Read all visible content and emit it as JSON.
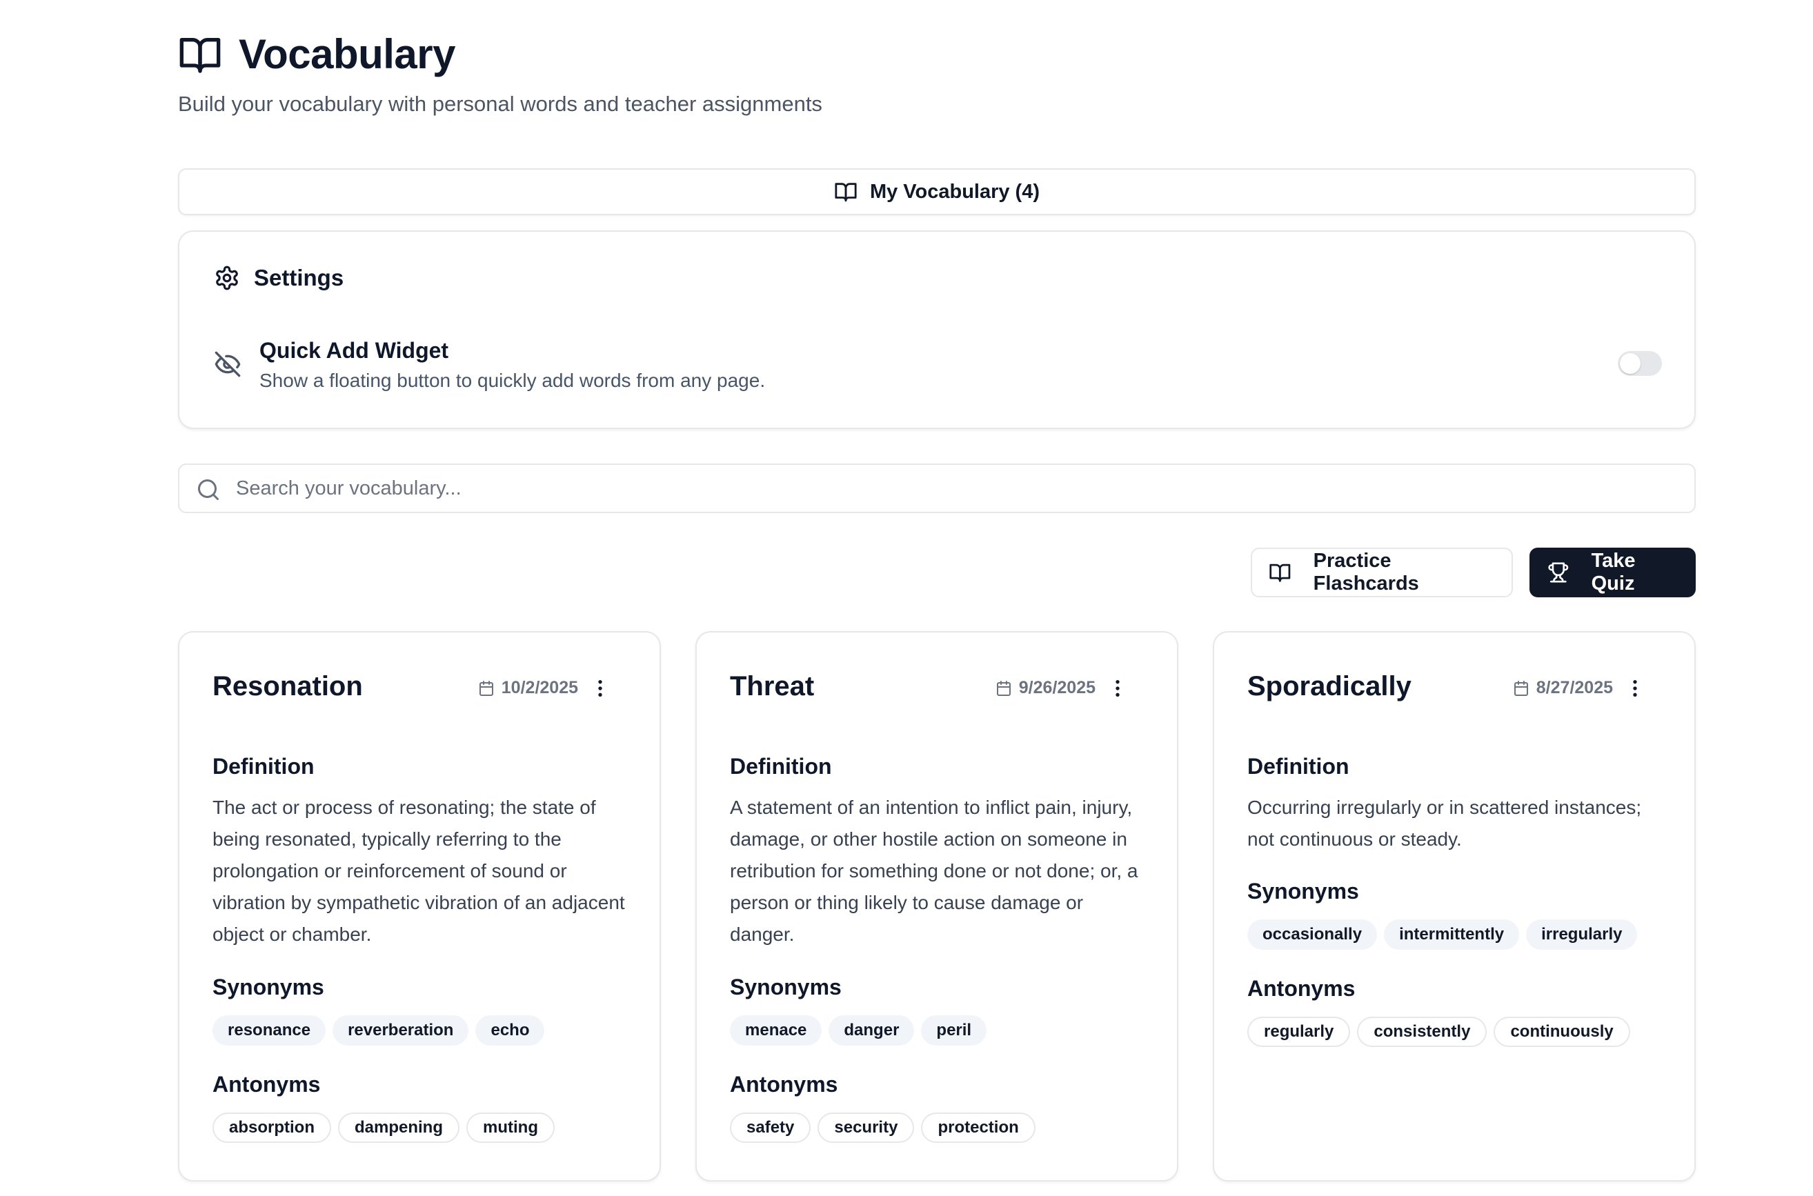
{
  "header": {
    "title": "Vocabulary",
    "subtitle": "Build your vocabulary with personal words and teacher assignments"
  },
  "tab": {
    "label": "My Vocabulary (4)"
  },
  "settings": {
    "title": "Settings",
    "quick_add": {
      "title": "Quick Add Widget",
      "description": "Show a floating button to quickly add words from any page.",
      "enabled": false
    }
  },
  "search": {
    "placeholder": "Search your vocabulary...",
    "value": ""
  },
  "actions": {
    "flashcards_label": "Practice Flashcards",
    "quiz_label": "Take Quiz"
  },
  "labels": {
    "definition": "Definition",
    "synonyms": "Synonyms",
    "antonyms": "Antonyms"
  },
  "words": [
    {
      "word": "Resonation",
      "date": "10/2/2025",
      "definition": "The act or process of resonating; the state of being resonated, typically referring to the prolongation or reinforcement of sound or vibration by sympathetic vibration of an adjacent object or chamber.",
      "synonyms": [
        "resonance",
        "reverberation",
        "echo"
      ],
      "antonyms": [
        "absorption",
        "dampening",
        "muting"
      ]
    },
    {
      "word": "Threat",
      "date": "9/26/2025",
      "definition": "A statement of an intention to inflict pain, injury, damage, or other hostile action on someone in retribution for something done or not done; or, a person or thing likely to cause damage or danger.",
      "synonyms": [
        "menace",
        "danger",
        "peril"
      ],
      "antonyms": [
        "safety",
        "security",
        "protection"
      ]
    },
    {
      "word": "Sporadically",
      "date": "8/27/2025",
      "definition": "Occurring irregularly or in scattered instances; not continuous or steady.",
      "synonyms": [
        "occasionally",
        "intermittently",
        "irregularly"
      ],
      "antonyms": [
        "regularly",
        "consistently",
        "continuously"
      ]
    }
  ],
  "colors": {
    "primary_dark": "#111827",
    "border": "#e5e7eb",
    "muted_text": "#6b7280",
    "tag_bg": "#f1f5f9"
  }
}
